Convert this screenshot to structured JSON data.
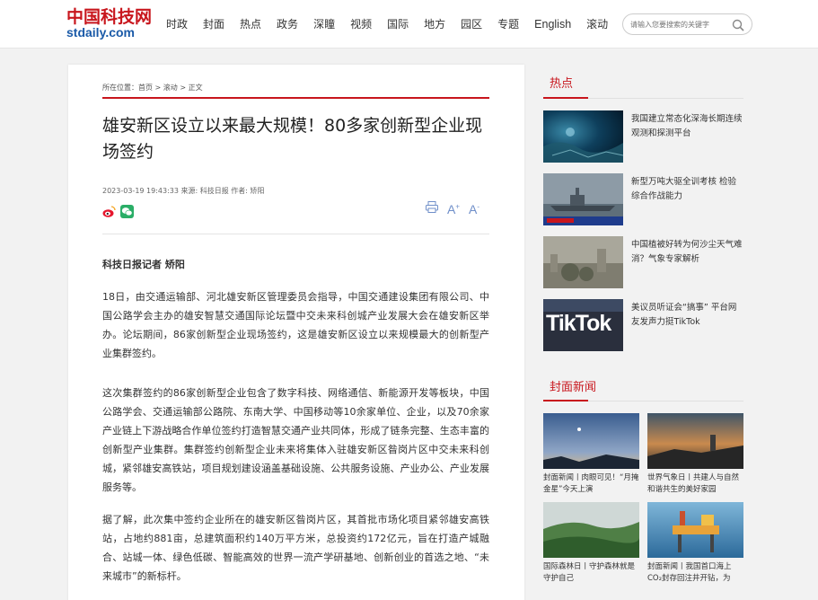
{
  "header": {
    "logo_cn": "中国科技网",
    "logo_en": "stdaily.com",
    "nav": [
      "时政",
      "封面",
      "热点",
      "政务",
      "深瞳",
      "视频",
      "国际",
      "地方",
      "园区",
      "专题",
      "English",
      "滚动"
    ],
    "search_placeholder": "请输入您要搜索的关键字"
  },
  "breadcrumb": {
    "prefix": "所在位置：",
    "home": "首页",
    "sep1": " > ",
    "section": "滚动",
    "sep2": " > ",
    "current": "正文"
  },
  "article": {
    "title": "雄安新区设立以来最大规模！80多家创新型企业现场签约",
    "meta": "2023-03-19 19:43:33 来源: 科技日报 作者: 矫阳",
    "tools": {
      "print": "print-icon",
      "font_larger": "A+",
      "font_smaller": "A-"
    },
    "author_line": "科技日报记者 矫阳",
    "paragraphs": [
      "18日，由交通运输部、河北雄安新区管理委员会指导，中国交通建设集团有限公司、中国公路学会主办的雄安智慧交通国际论坛暨中交未来科创城产业发展大会在雄安新区举办。论坛期间，86家创新型企业现场签约，这是雄安新区设立以来规模最大的创新型产业集群签约。",
      "这次集群签约的86家创新型企业包含了数字科技、网络通信、新能源开发等板块，中国公路学会、交通运输部公路院、东南大学、中国移动等10余家单位、企业，以及70余家产业链上下游战略合作单位签约打造智慧交通产业共同体，形成了链条完整、生态丰富的创新型产业集群。集群签约创新型企业未来将集体入驻雄安新区昝岗片区中交未来科创城，紧邻雄安高铁站，项目规划建设涵盖基础设施、公共服务设施、产业办公、产业发展服务等。",
      "据了解，此次集中签约企业所在的雄安新区昝岗片区，其首批市场化项目紧邻雄安高铁站，占地约881亩，总建筑面积约140万平方米，总投资约172亿元，旨在打造产城融合、站城一体、绿色低碳、智能高效的世界一流产学研基地、创新创业的首选之地、“未来城市”的新标杆。"
    ]
  },
  "sidebar": {
    "hot_title": "热点",
    "hot_items": [
      {
        "text": "我国建立常态化深海长期连续观测和探测平台",
        "image": "deep-sea-image"
      },
      {
        "text": "新型万吨大驱全训考核 检验综合作战能力",
        "image": "warship-image"
      },
      {
        "text": "中国植被好转为何沙尘天气难消？气象专家解析",
        "image": "dust-city-image"
      },
      {
        "text": "美议员听证会“搞事” 平台网友发声力挺TikTok",
        "image": "tiktok-image"
      }
    ],
    "tiktok_logo_text": "TikTok",
    "cover_title": "封面新闻",
    "cover_items": [
      {
        "text": "封面新闻丨肉眼可见！“月掩金星”今天上演",
        "image": "moon-venus-image"
      },
      {
        "text": "世界气象日丨共建人与自然和谐共生的美好家园",
        "image": "weather-station-image"
      },
      {
        "text": "国际森林日丨守护森林就是守护自己",
        "image": "forest-image"
      },
      {
        "text": "封面新闻丨我国首口海上CO₂封存回注井开钻，为",
        "image": "oil-platform-image"
      }
    ]
  },
  "colors": {
    "brand_red": "#c8161d",
    "logo_blue": "#1a5aa8",
    "tool_blue": "#6f8fc9"
  }
}
